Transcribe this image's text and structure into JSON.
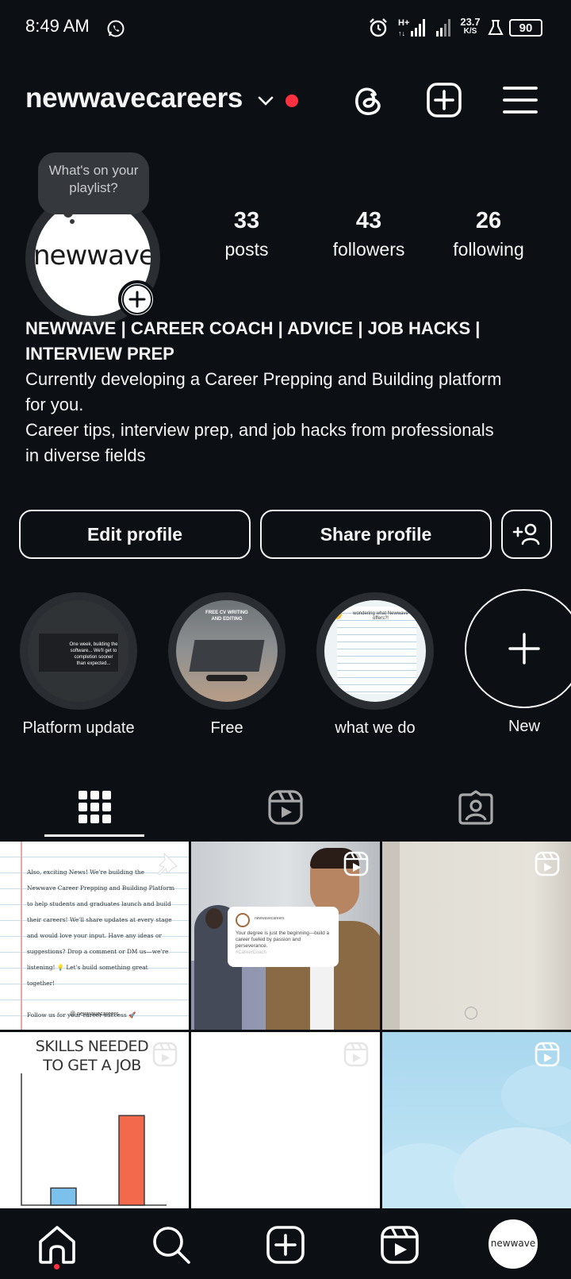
{
  "status_bar": {
    "time": "8:49 AM",
    "network_speed": "23.7",
    "network_unit": "K/S",
    "battery": "90",
    "icons": [
      "whatsapp-icon",
      "alarm-icon",
      "signal-icon",
      "signal-icon",
      "beaker-icon",
      "battery-icon"
    ]
  },
  "header": {
    "username": "newwavecareers",
    "icons": [
      "chevron-down-icon",
      "notification-dot",
      "threads-icon",
      "create-icon",
      "menu-icon"
    ]
  },
  "profile": {
    "note": "What's on your playlist?",
    "avatar_text": "newwave",
    "stats": [
      {
        "value": "33",
        "label": "posts"
      },
      {
        "value": "43",
        "label": "followers"
      },
      {
        "value": "26",
        "label": "following"
      }
    ],
    "bio_name_line1": "NEWWAVE | CAREER COACH | ADVICE | JOB HACKS |",
    "bio_name_line2": "INTERVIEW PREP",
    "bio_line1": "Currently developing a Career Prepping and Building platform",
    "bio_line2": "for you.",
    "bio_line3": "Career tips, interview prep, and job hacks from professionals",
    "bio_line4": "in diverse fields"
  },
  "actions": {
    "edit_profile": "Edit profile",
    "share_profile": "Share profile",
    "add_person_icon": "add-person-icon"
  },
  "highlights": [
    {
      "label": "Platform update",
      "thumb_text": "One week, building the software... We'll get to completion sooner than expected..."
    },
    {
      "label": "Free",
      "thumb_text": "FREE CV WRITING AND EDITING"
    },
    {
      "label": "what we do",
      "thumb_text": "wondering what Newwave offers?!"
    },
    {
      "label": "New"
    }
  ],
  "tabs": [
    "grid-icon",
    "reels-icon",
    "tagged-icon"
  ],
  "posts": [
    {
      "type": "note",
      "lines": [
        "Also, exciting News! We're building the",
        "Newwave Career Prepping and Building Platform",
        "to help students and graduates launch and build",
        "their careers! We'll share updates at every stage",
        "and would love your input. Have any ideas or",
        "suggestions? Drop a comment or DM us—we're",
        "listening! 💡 Let's build something great",
        "together!",
        "",
        "Follow us for your career success 🚀"
      ],
      "handle": "@ newwavecareers"
    },
    {
      "type": "reel",
      "card_account": "newwavecareers",
      "card_text": "Your degree is just the beginning—build a career fueled by passion and perseverance.",
      "card_tag": "#CareerCoach"
    },
    {
      "type": "reel"
    },
    {
      "type": "reel",
      "title_line1": "SKILLS NEEDED",
      "title_line2": "TO GET A JOB"
    },
    {
      "type": "reel"
    },
    {
      "type": "reel"
    }
  ],
  "chart_data": {
    "type": "bar",
    "title": "SKILLS NEEDED TO GET A JOB",
    "categories": [
      "",
      ""
    ],
    "values": [
      13,
      68
    ],
    "colors": [
      "#7cc0ec",
      "#f26a4b"
    ]
  },
  "bottom_nav": {
    "items": [
      "home-icon",
      "search-icon",
      "create-icon",
      "reels-icon",
      "profile-avatar"
    ],
    "avatar_text": "newwave"
  }
}
